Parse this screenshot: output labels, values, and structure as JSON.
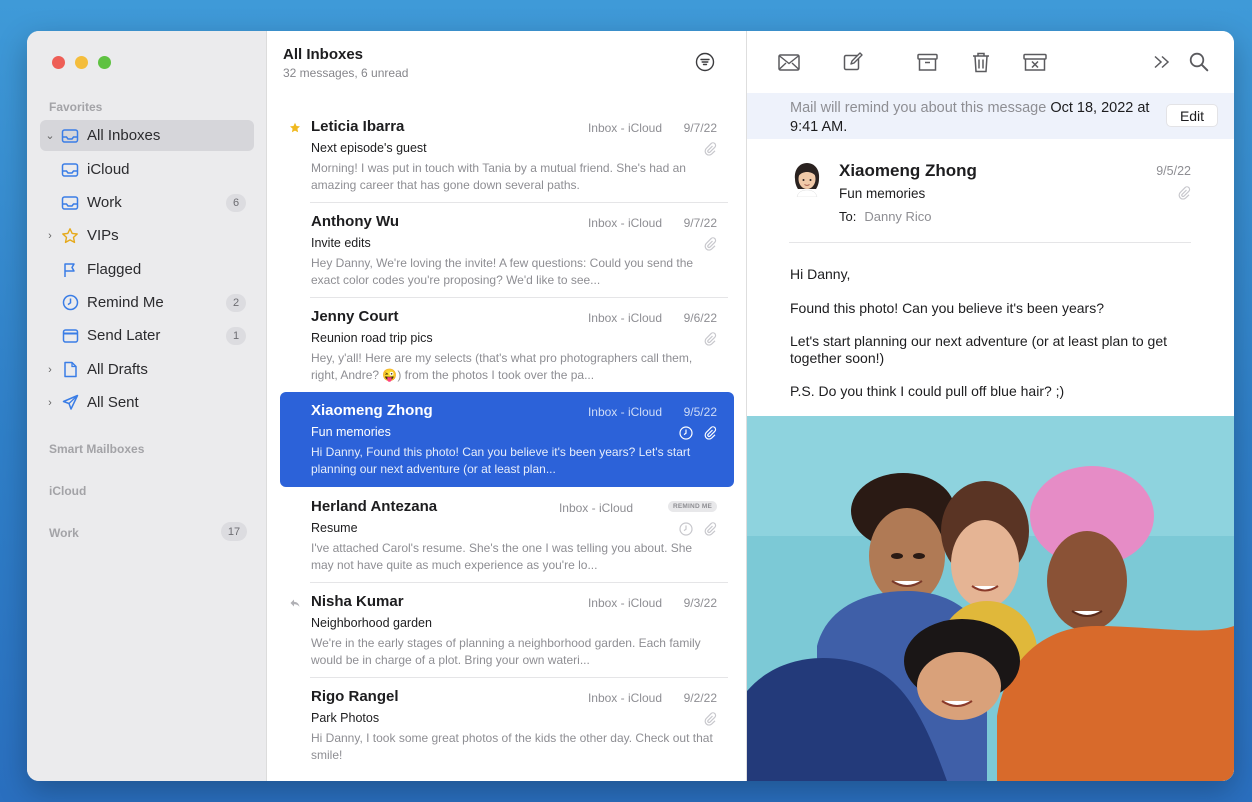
{
  "sidebar": {
    "favorites_label": "Favorites",
    "items": [
      {
        "label": "All Inboxes",
        "badge": ""
      },
      {
        "label": "iCloud",
        "badge": ""
      },
      {
        "label": "Work",
        "badge": "6"
      },
      {
        "label": "VIPs",
        "badge": ""
      },
      {
        "label": "Flagged",
        "badge": ""
      },
      {
        "label": "Remind Me",
        "badge": "2"
      },
      {
        "label": "Send Later",
        "badge": "1"
      },
      {
        "label": "All Drafts",
        "badge": ""
      },
      {
        "label": "All Sent",
        "badge": ""
      }
    ],
    "sections": [
      "Smart Mailboxes",
      "iCloud",
      "Work"
    ],
    "work_count": "17"
  },
  "list": {
    "title": "All Inboxes",
    "subtitle": "32 messages, 6 unread",
    "messages": [
      {
        "sender": "Leticia Ibarra",
        "mailbox": "Inbox - iCloud",
        "date": "9/7/22",
        "subject": "Next episode's guest",
        "preview": "Morning! I was put in touch with Tania by a mutual friend. She's had an amazing career that has gone down several paths."
      },
      {
        "sender": "Anthony Wu",
        "mailbox": "Inbox - iCloud",
        "date": "9/7/22",
        "subject": "Invite edits",
        "preview": "Hey Danny, We're loving the invite! A few questions: Could you send the exact color codes you're proposing? We'd like to see..."
      },
      {
        "sender": "Jenny Court",
        "mailbox": "Inbox - iCloud",
        "date": "9/6/22",
        "subject": "Reunion road trip pics",
        "preview": "Hey, y'all! Here are my selects (that's what pro photographers call them, right, Andre? 😜) from the photos I took over the pa..."
      },
      {
        "sender": "Xiaomeng Zhong",
        "mailbox": "Inbox - iCloud",
        "date": "9/5/22",
        "subject": "Fun memories",
        "preview": "Hi Danny, Found this photo! Can you believe it's been years? Let's start planning our next adventure (or at least plan..."
      },
      {
        "sender": "Herland Antezana",
        "mailbox": "Inbox - iCloud",
        "date": "",
        "tag": "REMIND ME",
        "subject": "Resume",
        "preview": "I've attached Carol's resume. She's the one I was telling you about. She may not have quite as much experience as you're lo..."
      },
      {
        "sender": "Nisha Kumar",
        "mailbox": "Inbox - iCloud",
        "date": "9/3/22",
        "subject": "Neighborhood garden",
        "preview": "We're in the early stages of planning a neighborhood garden. Each family would be in charge of a plot. Bring your own wateri..."
      },
      {
        "sender": "Rigo Rangel",
        "mailbox": "Inbox - iCloud",
        "date": "9/2/22",
        "subject": "Park Photos",
        "preview": "Hi Danny, I took some great photos of the kids the other day. Check out that smile!"
      }
    ]
  },
  "reader": {
    "banner_prefix": "Mail will remind you about this message",
    "banner_date": "Oct 18, 2022 at 9:41 AM.",
    "edit_label": "Edit",
    "sender": "Xiaomeng Zhong",
    "date": "9/5/22",
    "subject": "Fun memories",
    "to_label": "To:",
    "to_name": "Danny Rico",
    "body": [
      "Hi Danny,",
      "Found this photo! Can you believe it's been years?",
      "Let's start planning our next adventure (or at least plan to get together soon!)",
      "P.S. Do you think I could pull off blue hair? ;)"
    ]
  },
  "colors": {
    "accent": "#2c62d9",
    "sidebar_bg": "#ebebed",
    "banner_bg": "#eef2fb"
  },
  "icons": [
    "envelope-icon",
    "compose-icon",
    "archive-icon",
    "trash-icon",
    "junk-icon",
    "more-icon",
    "search-icon",
    "filter-icon",
    "star-icon",
    "reply-icon",
    "paperclip-icon",
    "clock-icon"
  ]
}
